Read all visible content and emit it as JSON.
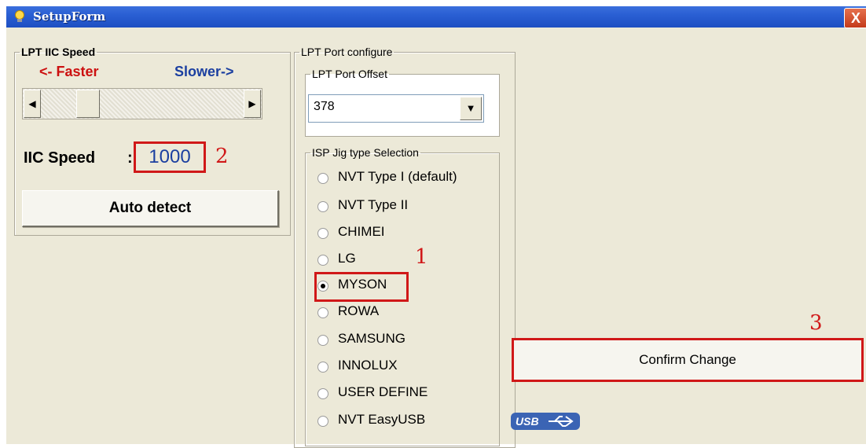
{
  "window": {
    "title": "SetupForm",
    "close_glyph": "X",
    "title_icon": "lightbulb-icon"
  },
  "speed_group": {
    "legend": "LPT IIC Speed",
    "faster_label": "<- Faster",
    "slower_label": "Slower->",
    "slider_position": 0.2,
    "iic_label": "IIC Speed",
    "iic_colon": ":",
    "iic_value": "1000",
    "auto_detect_label": "Auto detect"
  },
  "port_group": {
    "legend": "LPT Port configure",
    "offset_legend": "LPT Port Offset",
    "offset_value": "378"
  },
  "jig_group": {
    "legend": "ISP Jig type Selection",
    "options": [
      {
        "label": "NVT Type I (default)",
        "selected": false
      },
      {
        "label": "NVT Type II",
        "selected": false
      },
      {
        "label": "CHIMEI",
        "selected": false
      },
      {
        "label": "LG",
        "selected": false
      },
      {
        "label": "MYSON",
        "selected": true
      },
      {
        "label": "ROWA",
        "selected": false
      },
      {
        "label": "SAMSUNG",
        "selected": false
      },
      {
        "label": "INNOLUX",
        "selected": false
      },
      {
        "label": "USER DEFINE",
        "selected": false
      },
      {
        "label": "NVT EasyUSB",
        "selected": false
      }
    ]
  },
  "confirm_label": "Confirm Change",
  "usb_logo_text": "USB",
  "annotations": {
    "one": "1",
    "two": "2",
    "three": "3"
  },
  "colors": {
    "annotation_red": "#d01818",
    "title_blue": "#2a5fd3",
    "faster_red": "#cc1010",
    "slower_blue": "#1b3fa0"
  }
}
